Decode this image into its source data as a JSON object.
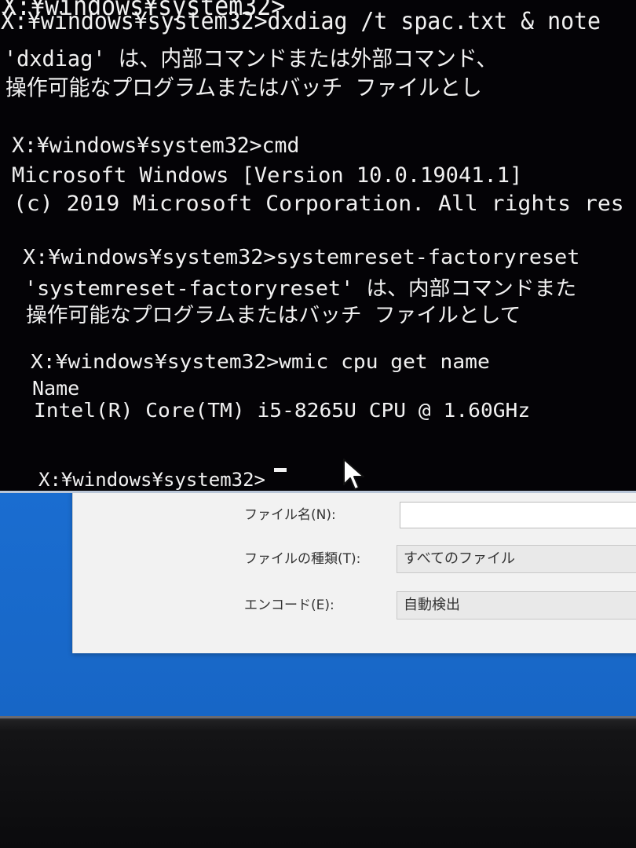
{
  "console": {
    "lines": [
      "X:¥windows¥system32>",
      "X:¥windows¥system32>dxdiag /t spac.txt & note",
      "'dxdiag' は、内部コマンドまたは外部コマンド、",
      "操作可能なプログラムまたはバッチ ファイルとし",
      "X:¥windows¥system32>cmd",
      "Microsoft Windows [Version 10.0.19041.1]",
      "(c) 2019 Microsoft Corporation. All rights res",
      "X:¥windows¥system32>systemreset-factoryreset",
      "'systemreset-factoryreset' は、内部コマンドまた",
      "操作可能なプログラムまたはバッチ ファイルとして",
      "X:¥windows¥system32>wmic cpu get name",
      "Name",
      "Intel(R) Core(TM) i5-8265U CPU @ 1.60GHz",
      "X:¥windows¥system32>"
    ],
    "colors": {
      "background": "#040306",
      "text": "#f1f1f1"
    }
  },
  "dialog": {
    "filename_label": "ファイル名(N):",
    "filename_value": "",
    "filetype_label": "ファイルの種類(T):",
    "filetype_value": "すべてのファイル",
    "encoding_label": "エンコード(E):",
    "encoding_value": "自動検出"
  },
  "icons": {
    "pointer": "mouse-pointer-icon"
  },
  "colors": {
    "desktop_blue": "#1a73d8",
    "dialog_bg": "#f2f2f2",
    "bezel": "#141416"
  }
}
